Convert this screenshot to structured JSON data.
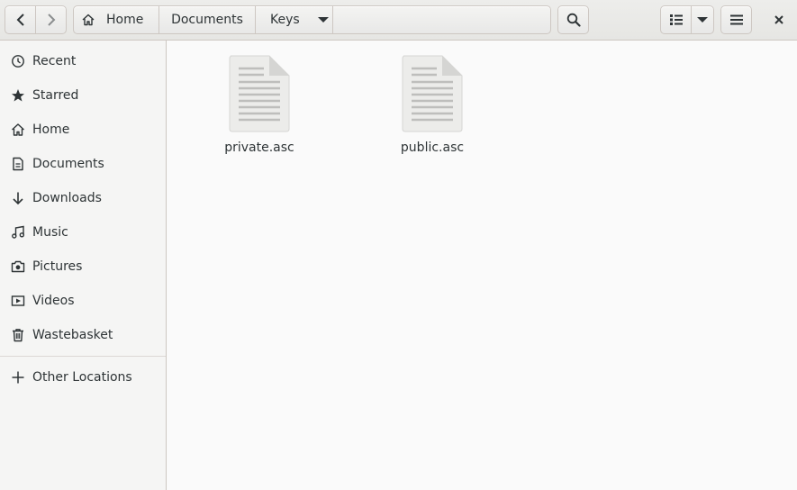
{
  "header": {
    "breadcrumbs": [
      {
        "label": "Home"
      },
      {
        "label": "Documents"
      },
      {
        "label": "Keys"
      }
    ]
  },
  "sidebar": {
    "items": [
      {
        "label": "Recent",
        "icon": "clock-icon"
      },
      {
        "label": "Starred",
        "icon": "star-icon"
      },
      {
        "label": "Home",
        "icon": "home-icon"
      },
      {
        "label": "Documents",
        "icon": "document-icon"
      },
      {
        "label": "Downloads",
        "icon": "download-icon"
      },
      {
        "label": "Music",
        "icon": "music-icon"
      },
      {
        "label": "Pictures",
        "icon": "camera-icon"
      },
      {
        "label": "Videos",
        "icon": "video-icon"
      },
      {
        "label": "Wastebasket",
        "icon": "trash-icon"
      }
    ],
    "other_locations": {
      "label": "Other Locations",
      "icon": "plus-icon"
    }
  },
  "files": [
    {
      "name": "private.asc",
      "icon": "text-file-icon"
    },
    {
      "name": "public.asc",
      "icon": "text-file-icon"
    }
  ]
}
